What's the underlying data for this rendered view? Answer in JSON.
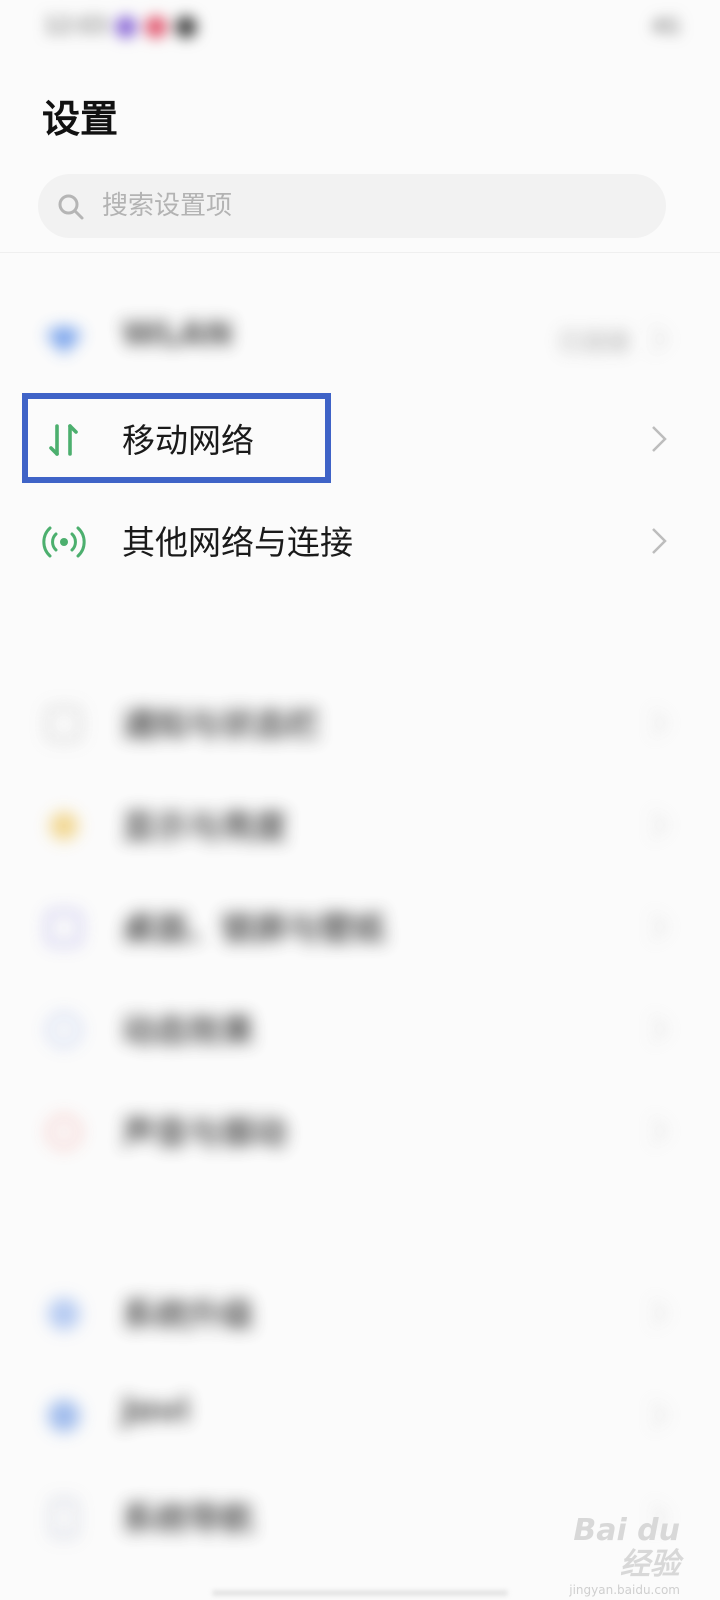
{
  "status_bar": {
    "clock": "12:03",
    "dot_colors": [
      "#8c6bd6",
      "#e0566e",
      "#444444"
    ],
    "right_text": "4G"
  },
  "header": {
    "title": "设置"
  },
  "search": {
    "placeholder": "搜索设置项",
    "value": ""
  },
  "network_group": [
    {
      "label": "WLAN",
      "value": "已连接",
      "icon": "wifi-icon",
      "blurred": true
    },
    {
      "label": "移动网络",
      "value": "",
      "icon": "mobile-data-icon",
      "blurred": false,
      "highlighted": true
    },
    {
      "label": "其他网络与连接",
      "value": "",
      "icon": "hotspot-icon",
      "blurred": false
    }
  ],
  "display_group": [
    {
      "label": "通知与状态栏",
      "icon": "notification-icon"
    },
    {
      "label": "显示与亮度",
      "icon": "brightness-icon"
    },
    {
      "label": "桌面、锁屏与壁纸",
      "icon": "wallpaper-icon"
    },
    {
      "label": "动态效果",
      "icon": "animation-icon"
    },
    {
      "label": "声音与振动",
      "icon": "sound-icon"
    }
  ],
  "system_group": [
    {
      "label": "系统升级",
      "icon": "update-icon"
    },
    {
      "label": "Jovi",
      "icon": "jovi-icon"
    },
    {
      "label": "系统导航",
      "icon": "navigation-icon"
    }
  ],
  "colors": {
    "accent_green": "#4caf6e",
    "highlight_blue": "#3f63c7"
  },
  "watermark": {
    "brand": "Bai du 经验",
    "sub": "jingyan.baidu.com"
  }
}
